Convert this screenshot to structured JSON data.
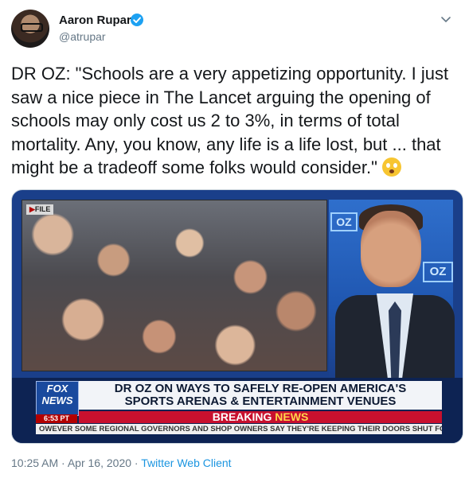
{
  "author": {
    "name": "Aaron Rupar",
    "handle": "@atrupar",
    "verified": true
  },
  "tweet": {
    "text": "DR OZ: \"Schools are a very appetizing opportunity. I just saw a nice piece in The Lancet arguing the opening of schools may only cost us 2 to 3%, in terms of total mortality. Any, you know, any life is a life lost, but ... that might be a tradeoff some folks would consider.\"",
    "emoji": "flushed-face-emoji"
  },
  "media": {
    "file_tag_play": "▶",
    "file_tag": "FILE",
    "network_top": "FOX",
    "network_bottom": "NEWS",
    "time": "6:53 PT",
    "headline_line1": "DR OZ ON WAYS TO SAFELY RE-OPEN AMERICA'S",
    "headline_line2": "SPORTS ARENAS & ENTERTAINMENT VENUES",
    "breaking_1": "BREAKING",
    "breaking_2": "NEWS",
    "ticker": "OWEVER SOME REGIONAL GOVERNORS AND SHOP OWNERS SAY THEY'RE KEEPING THEIR DOORS SHUT FO",
    "logo_text": "OZ"
  },
  "footer": {
    "time": "10:25 AM",
    "separator": "·",
    "date": "Apr 16, 2020",
    "client": "Twitter Web Client"
  },
  "colors": {
    "link": "#1b95e0",
    "verified": "#1da1f2",
    "breaking": "#c8102e"
  }
}
